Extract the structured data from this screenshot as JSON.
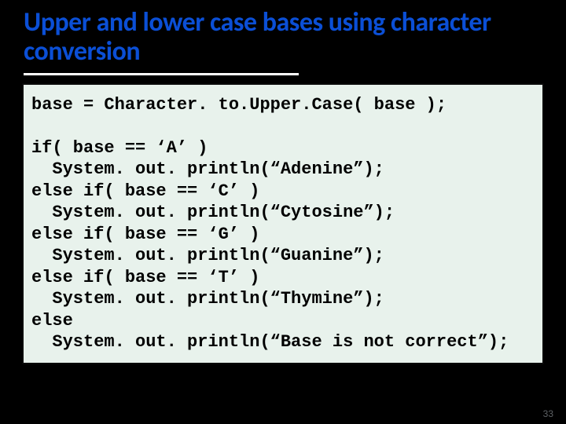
{
  "slide": {
    "title": "Upper and lower case bases using character conversion",
    "page_number": "33",
    "code": {
      "l1": "base = Character. to.Upper.Case( base );",
      "blank": "",
      "l2": "if( base == ‘A’ )",
      "l3": "  System. out. println(“Adenine”);",
      "l4": "else if( base == ‘C’ )",
      "l5": "  System. out. println(“Cytosine”);",
      "l6": "else if( base == ‘G’ )",
      "l7": "  System. out. println(“Guanine”);",
      "l8": "else if( base == ‘T’ )",
      "l9": "  System. out. println(“Thymine”);",
      "l10": "else",
      "l11": "  System. out. println(“Base is not correct”);"
    }
  }
}
